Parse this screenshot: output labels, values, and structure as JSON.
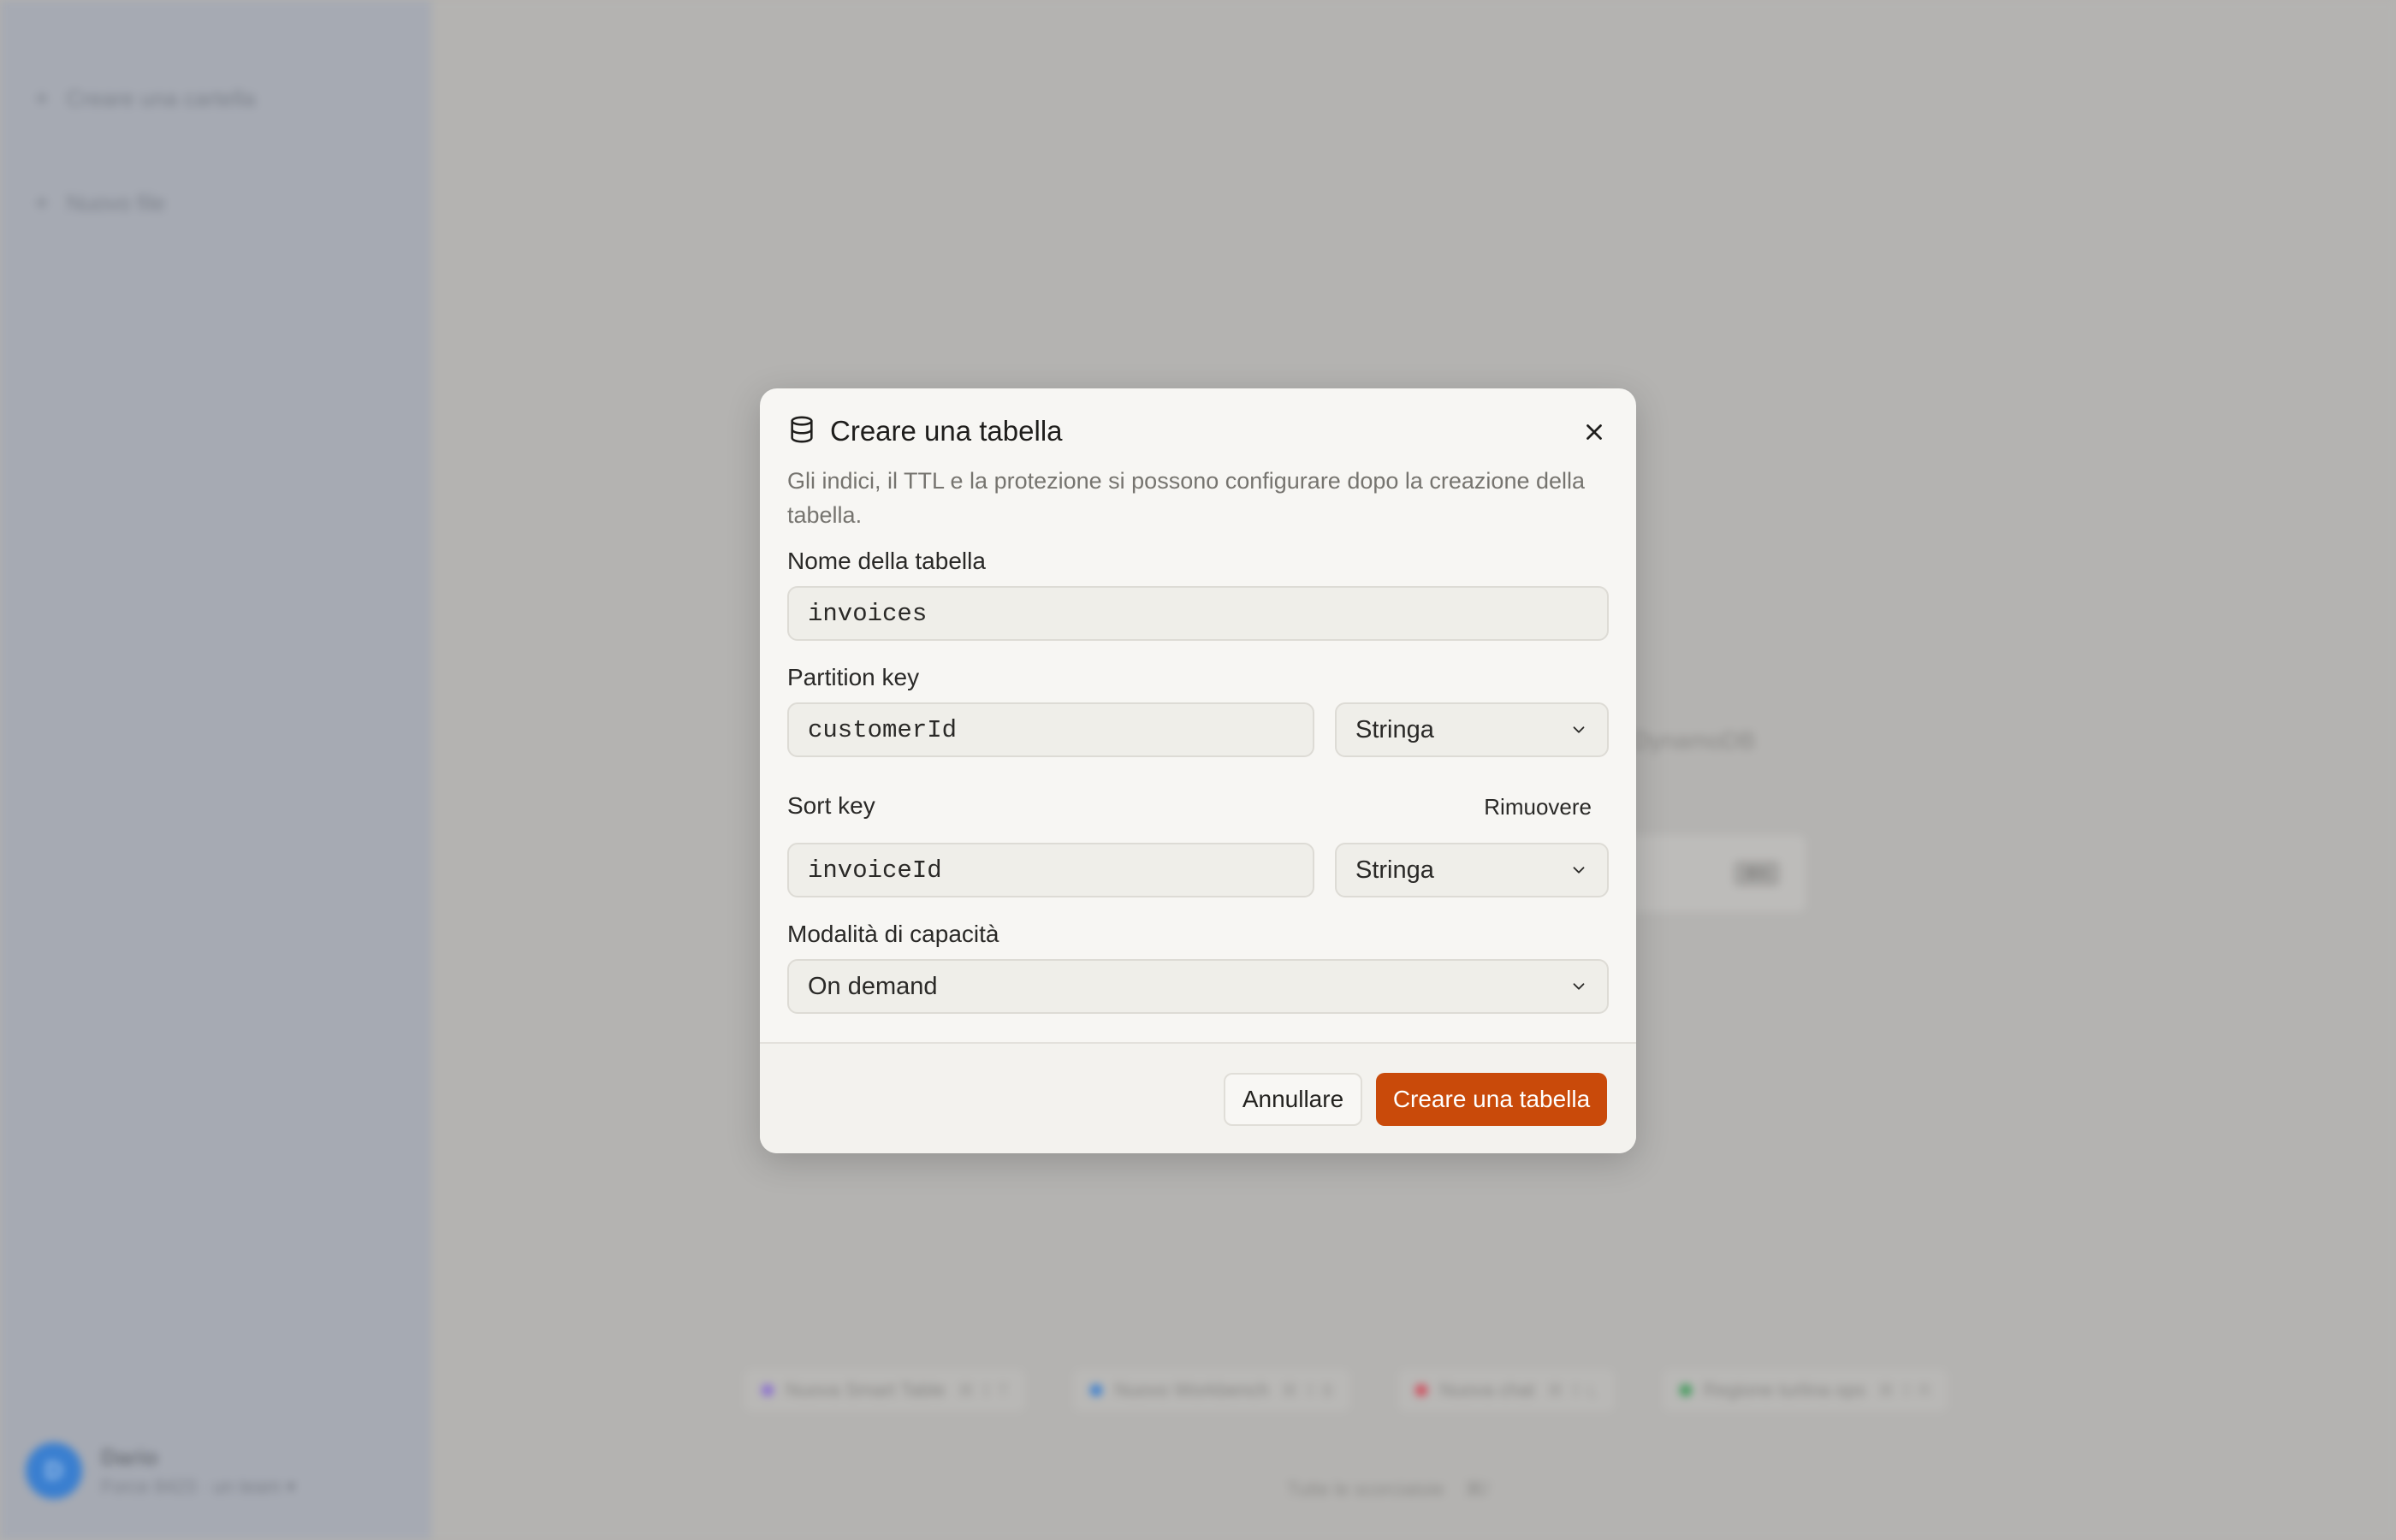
{
  "sidebar": {
    "items": [
      {
        "label": "Creare una cartella"
      },
      {
        "label": "Nuovo file"
      }
    ],
    "user": {
      "initials": "D",
      "name": "Dario",
      "subtitle": "Force 8423 · un team ▾"
    }
  },
  "background": {
    "fragment": "DynamoDB",
    "card_chip": "⌘K",
    "pills": [
      {
        "label": "Nuova Smart Table",
        "shortcut": "⌘ ⇧ T",
        "color": "#8a6fd0"
      },
      {
        "label": "Nuovo Workbench",
        "shortcut": "⌘ ⇧ B",
        "color": "#3a7fd0"
      },
      {
        "label": "Nuova chat",
        "shortcut": "⌘ ⇧ L",
        "color": "#d04a5a"
      },
      {
        "label": "Regione turlina ops",
        "shortcut": "⌘ ⇧ R",
        "color": "#3f9a5a"
      }
    ],
    "footer": {
      "label": "Tutte le scorciatoie",
      "shortcut": "⌘/"
    }
  },
  "modal": {
    "title": "Creare una tabella",
    "description": "Gli indici, il TTL e la protezione si possono configurare dopo la creazione della tabella.",
    "table_name": {
      "label": "Nome della tabella",
      "value": "invoices"
    },
    "partition_key": {
      "label": "Partition key",
      "value": "customerId",
      "type": "Stringa"
    },
    "sort_key": {
      "label": "Sort key",
      "remove_label": "Rimuovere",
      "value": "invoiceId",
      "type": "Stringa"
    },
    "capacity": {
      "label": "Modalità di capacità",
      "value": "On demand"
    },
    "cancel_label": "Annullare",
    "create_label": "Creare una tabella"
  },
  "colors": {
    "accent": "#c94a0a",
    "overlay": "#b3b2b0",
    "modal_bg": "#f7f6f3"
  }
}
